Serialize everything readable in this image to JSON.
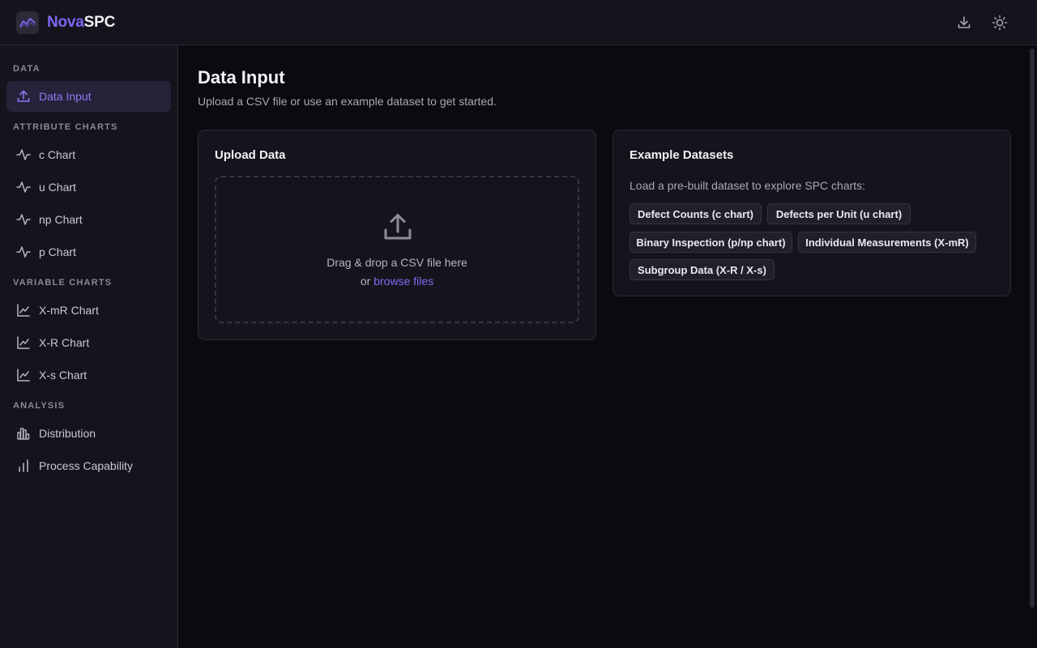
{
  "header": {
    "brand_part1": "Nova",
    "brand_part2": "SPC",
    "logo_icon": "chart-line-icon",
    "download_icon": "download-icon",
    "theme_icon": "sun-icon"
  },
  "sidebar": {
    "sections": [
      {
        "title": "DATA",
        "items": [
          {
            "label": "Data Input",
            "icon": "upload-icon",
            "active": true
          }
        ]
      },
      {
        "title": "ATTRIBUTE CHARTS",
        "items": [
          {
            "label": "c Chart",
            "icon": "activity-icon"
          },
          {
            "label": "u Chart",
            "icon": "activity-icon"
          },
          {
            "label": "np Chart",
            "icon": "activity-icon"
          },
          {
            "label": "p Chart",
            "icon": "activity-icon"
          }
        ]
      },
      {
        "title": "VARIABLE CHARTS",
        "items": [
          {
            "label": "X-mR Chart",
            "icon": "line-chart-icon"
          },
          {
            "label": "X-R Chart",
            "icon": "line-chart-icon"
          },
          {
            "label": "X-s Chart",
            "icon": "line-chart-icon"
          }
        ]
      },
      {
        "title": "ANALYSIS",
        "items": [
          {
            "label": "Distribution",
            "icon": "histogram-icon"
          },
          {
            "label": "Process Capability",
            "icon": "bar-chart-icon"
          }
        ]
      }
    ]
  },
  "main": {
    "title": "Data Input",
    "subtitle": "Upload a CSV file or use an example dataset to get started.",
    "upload": {
      "title": "Upload Data",
      "drop_text": "Drag & drop a CSV file here",
      "or_text": "or",
      "browse_text": "browse files"
    },
    "examples": {
      "title": "Example Datasets",
      "description": "Load a pre-built dataset to explore SPC charts:",
      "datasets": [
        "Defect Counts (c chart)",
        "Defects per Unit (u chart)",
        "Binary Inspection (p/np chart)",
        "Individual Measurements (X-mR)",
        "Subgroup Data (X-R / X-s)"
      ]
    }
  },
  "colors": {
    "accent": "#7c67f0",
    "background": "#0b0a0f",
    "panel": "#15141d"
  }
}
